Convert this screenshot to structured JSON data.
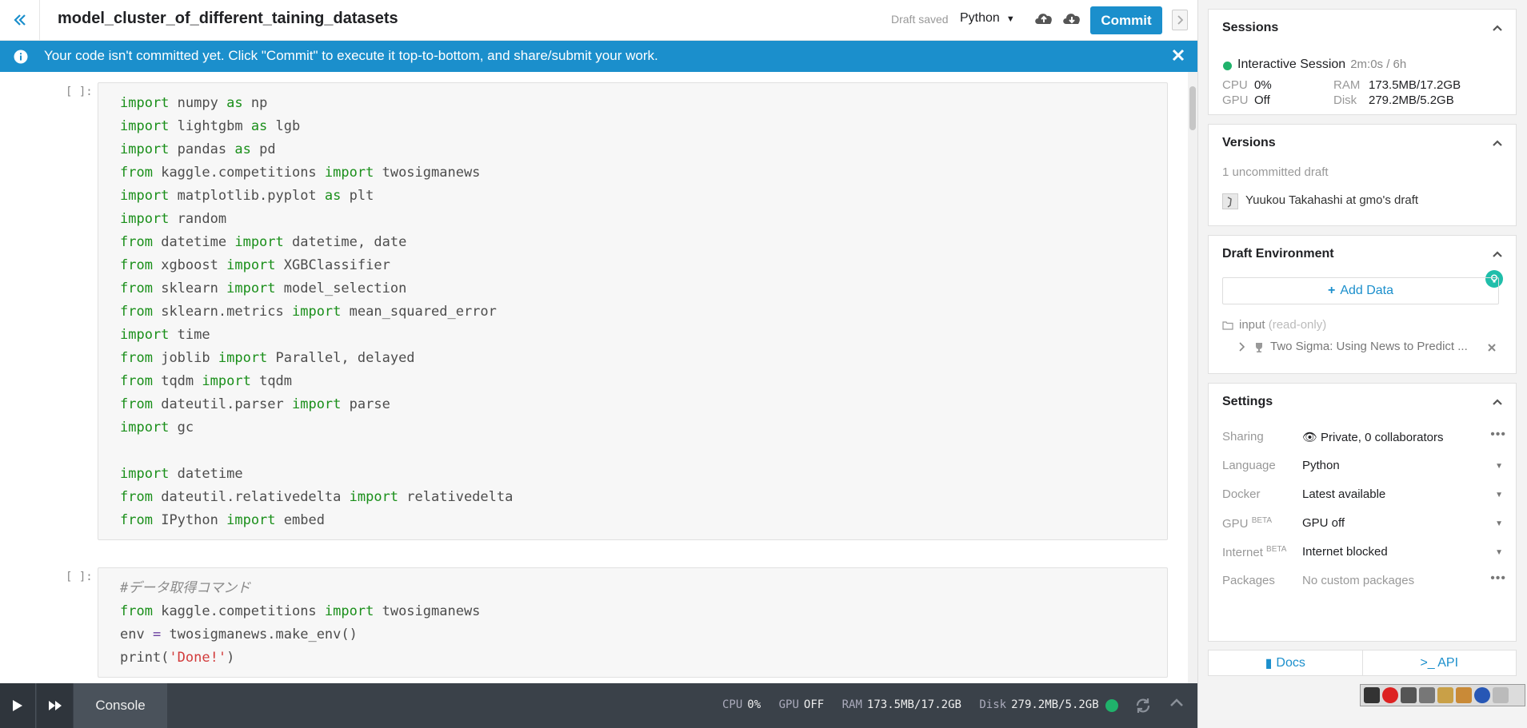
{
  "header": {
    "title": "model_cluster_of_different_taining_datasets",
    "draft_status": "Draft saved",
    "language": "Python",
    "commit_label": "Commit"
  },
  "banner": {
    "message": "Your code isn't committed yet. Click \"Commit\" to execute it top-to-bottom, and share/submit your work."
  },
  "cells": [
    {
      "prompt": "[ ]:",
      "lines": [
        [
          [
            "kw",
            "import"
          ],
          [
            "",
            "numpy"
          ],
          [
            "kw",
            "as"
          ],
          [
            "",
            "np"
          ]
        ],
        [
          [
            "kw",
            "import"
          ],
          [
            "",
            "lightgbm"
          ],
          [
            "kw",
            "as"
          ],
          [
            "",
            "lgb"
          ]
        ],
        [
          [
            "kw",
            "import"
          ],
          [
            "",
            "pandas"
          ],
          [
            "kw",
            "as"
          ],
          [
            "",
            "pd"
          ]
        ],
        [
          [
            "kw",
            "from"
          ],
          [
            "",
            "kaggle.competitions"
          ],
          [
            "kw",
            "import"
          ],
          [
            "",
            "twosigmanews"
          ]
        ],
        [
          [
            "kw",
            "import"
          ],
          [
            "",
            "matplotlib.pyplot"
          ],
          [
            "kw",
            "as"
          ],
          [
            "",
            "plt"
          ]
        ],
        [
          [
            "kw",
            "import"
          ],
          [
            "",
            "random"
          ]
        ],
        [
          [
            "kw",
            "from"
          ],
          [
            "",
            "datetime"
          ],
          [
            "kw",
            "import"
          ],
          [
            "",
            "datetime, date"
          ]
        ],
        [
          [
            "kw",
            "from"
          ],
          [
            "",
            "xgboost"
          ],
          [
            "kw",
            "import"
          ],
          [
            "",
            "XGBClassifier"
          ]
        ],
        [
          [
            "kw",
            "from"
          ],
          [
            "",
            "sklearn"
          ],
          [
            "kw",
            "import"
          ],
          [
            "",
            "model_selection"
          ]
        ],
        [
          [
            "kw",
            "from"
          ],
          [
            "",
            "sklearn.metrics"
          ],
          [
            "kw",
            "import"
          ],
          [
            "",
            "mean_squared_error"
          ]
        ],
        [
          [
            "kw",
            "import"
          ],
          [
            "",
            "time"
          ]
        ],
        [
          [
            "kw",
            "from"
          ],
          [
            "",
            "joblib"
          ],
          [
            "kw",
            "import"
          ],
          [
            "",
            "Parallel, delayed"
          ]
        ],
        [
          [
            "kw",
            "from"
          ],
          [
            "",
            "tqdm"
          ],
          [
            "kw",
            "import"
          ],
          [
            "",
            "tqdm"
          ]
        ],
        [
          [
            "kw",
            "from"
          ],
          [
            "",
            "dateutil.parser"
          ],
          [
            "kw",
            "import"
          ],
          [
            "",
            "parse"
          ]
        ],
        [
          [
            "kw",
            "import"
          ],
          [
            "",
            "gc"
          ]
        ],
        [],
        [
          [
            "kw",
            "import"
          ],
          [
            "",
            "datetime"
          ]
        ],
        [
          [
            "kw",
            "from"
          ],
          [
            "",
            "dateutil.relativedelta"
          ],
          [
            "kw",
            "import"
          ],
          [
            "",
            "relativedelta"
          ]
        ],
        [
          [
            "kw",
            "from"
          ],
          [
            "",
            "IPython"
          ],
          [
            "kw",
            "import"
          ],
          [
            "",
            "embed"
          ]
        ]
      ]
    },
    {
      "prompt": "[ ]:",
      "lines": [
        [
          [
            "cm",
            "#データ取得コマンド"
          ]
        ],
        [
          [
            "kw",
            "from"
          ],
          [
            "",
            "kaggle.competitions"
          ],
          [
            "kw",
            "import"
          ],
          [
            "",
            "twosigmanews"
          ]
        ],
        [
          [
            "",
            "env"
          ],
          [
            "op",
            "="
          ],
          [
            "",
            "twosigmanews.make_env()"
          ]
        ],
        [
          [
            "",
            "print("
          ],
          [
            "st",
            "'Done!'"
          ],
          [
            "",
            ")"
          ]
        ]
      ]
    }
  ],
  "console": {
    "tab_label": "Console",
    "cpu_label": "CPU",
    "cpu_value": "0%",
    "gpu_label": "GPU",
    "gpu_value": "OFF",
    "ram_label": "RAM",
    "ram_value": "173.5MB/17.2GB",
    "disk_label": "Disk",
    "disk_value": "279.2MB/5.2GB"
  },
  "sidebar": {
    "sessions": {
      "title": "Sessions",
      "session_name": "Interactive Session",
      "session_time": "2m:0s / 6h",
      "cpu_label": "CPU",
      "cpu_value": "0%",
      "gpu_label": "GPU",
      "gpu_value": "Off",
      "ram_label": "RAM",
      "ram_value": "173.5MB/17.2GB",
      "disk_label": "Disk",
      "disk_value": "279.2MB/5.2GB"
    },
    "versions": {
      "title": "Versions",
      "uncommitted": "1 uncommitted draft",
      "author_draft": "Yuukou Takahashi at gmo's draft"
    },
    "draft_environment": {
      "title": "Draft Environment",
      "add_data_label": "Add Data",
      "input_folder": "input",
      "input_readonly": "(read-only)",
      "dataset_name": "Two Sigma: Using News to Predict ..."
    },
    "settings": {
      "title": "Settings",
      "rows": [
        {
          "label": "Sharing",
          "beta": "",
          "value": "Private, 0 collaborators",
          "control": "dots"
        },
        {
          "label": "Language",
          "beta": "",
          "value": "Python",
          "control": "caret"
        },
        {
          "label": "Docker",
          "beta": "",
          "value": "Latest available",
          "control": "caret"
        },
        {
          "label": "GPU",
          "beta": "BETA",
          "value": "GPU off",
          "control": "caret"
        },
        {
          "label": "Internet",
          "beta": "BETA",
          "value": "Internet blocked",
          "control": "caret"
        },
        {
          "label": "Packages",
          "beta": "",
          "value": "No custom packages",
          "control": "dots"
        }
      ]
    },
    "docs_label": "Docs",
    "api_label": ">_ API"
  },
  "colors": {
    "accent": "#1b8fcc",
    "status_green": "#20b26b",
    "keyword": "#1a8f1a",
    "string": "#d23b3b"
  }
}
